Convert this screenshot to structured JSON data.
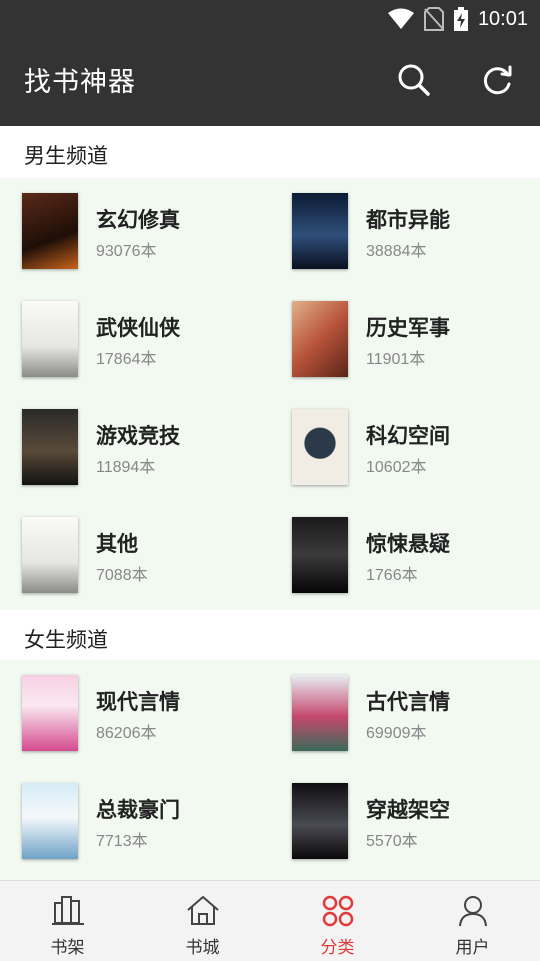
{
  "status": {
    "time": "10:01"
  },
  "header": {
    "title": "找书神器"
  },
  "male_section": {
    "title": "男生频道",
    "items": [
      {
        "name": "玄幻修真",
        "count": "93076本",
        "cover_colors": [
          "#3a1e14",
          "#c9651c"
        ]
      },
      {
        "name": "都市异能",
        "count": "38884本",
        "cover_colors": [
          "#0c1a33",
          "#2f4f7a"
        ]
      },
      {
        "name": "武侠仙侠",
        "count": "17864本",
        "cover_colors": [
          "#f4f4f2",
          "#9a9a9a"
        ]
      },
      {
        "name": "历史军事",
        "count": "11901本",
        "cover_colors": [
          "#b8533a",
          "#e0b18a"
        ]
      },
      {
        "name": "游戏竞技",
        "count": "11894本",
        "cover_colors": [
          "#1b1b1b",
          "#5a4a3a"
        ]
      },
      {
        "name": "科幻空间",
        "count": "10602本",
        "cover_colors": [
          "#f2ede4",
          "#2a3a4a"
        ]
      },
      {
        "name": "其他",
        "count": "7088本",
        "cover_colors": [
          "#f4f4f2",
          "#9a9a9a"
        ]
      },
      {
        "name": "惊悚悬疑",
        "count": "1766本",
        "cover_colors": [
          "#0a0a0a",
          "#3a3a3a"
        ]
      }
    ]
  },
  "female_section": {
    "title": "女生频道",
    "items": [
      {
        "name": "现代言情",
        "count": "86206本",
        "cover_colors": [
          "#f6d0e4",
          "#d44a8e"
        ]
      },
      {
        "name": "古代言情",
        "count": "69909本",
        "cover_colors": [
          "#e8eef2",
          "#c4486f"
        ]
      },
      {
        "name": "总裁豪门",
        "count": "7713本",
        "cover_colors": [
          "#d7ecf7",
          "#6fa3c8"
        ]
      },
      {
        "name": "穿越架空",
        "count": "5570本",
        "cover_colors": [
          "#0e0e12",
          "#4a4a52"
        ]
      }
    ]
  },
  "nav": {
    "items": [
      {
        "label": "书架"
      },
      {
        "label": "书城"
      },
      {
        "label": "分类"
      },
      {
        "label": "用户"
      }
    ]
  },
  "colors": {
    "bar": "#333333",
    "accent": "#e23a3a",
    "grid_bg": "#f1f9f1"
  }
}
